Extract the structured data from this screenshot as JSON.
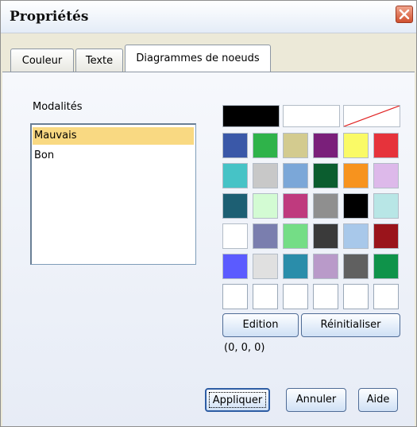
{
  "window": {
    "title": "Propriétés",
    "close_icon": "close-x-icon"
  },
  "tabs": [
    {
      "label": "Couleur",
      "active": false
    },
    {
      "label": "Texte",
      "active": false
    },
    {
      "label": "Diagrammes de noeuds",
      "active": true
    }
  ],
  "modalites": {
    "label": "Modalités",
    "items": [
      {
        "label": "Mauvais",
        "selected": true
      },
      {
        "label": "Bon",
        "selected": false
      }
    ]
  },
  "palette": {
    "special": [
      {
        "name": "black",
        "color": "#000000"
      },
      {
        "name": "white",
        "color": "#ffffff"
      },
      {
        "name": "none",
        "color": "none"
      }
    ],
    "grid": [
      [
        "#3a58a8",
        "#2fb34a",
        "#d3cb8f",
        "#7a1f7a",
        "#fafa66",
        "#e6333b"
      ],
      [
        "#46c3c6",
        "#c8c8c8",
        "#7ba7d8",
        "#0b5d2f",
        "#f7931e",
        "#ddb9ea"
      ],
      [
        "#1d5f73",
        "#d3fbd3",
        "#bf3a7e",
        "#8f8f8f",
        "#000000",
        "#b8e6e6"
      ],
      [
        "#ffffff",
        "#7a7eae",
        "#74dd86",
        "#3a3a3a",
        "#a8c8ea",
        "#9a141b"
      ],
      [
        "#5b5bff",
        "#e0e0e0",
        "#2a8daa",
        "#b99ac9",
        "#606060",
        "#0f934a"
      ],
      [
        "empty",
        "empty",
        "empty",
        "empty",
        "empty",
        "empty"
      ]
    ]
  },
  "buttons": {
    "edition": "Edition",
    "reset": "Réinitialiser",
    "apply": "Appliquer",
    "cancel": "Annuler",
    "help": "Aide"
  },
  "rgb_readout": "(0, 0, 0)"
}
